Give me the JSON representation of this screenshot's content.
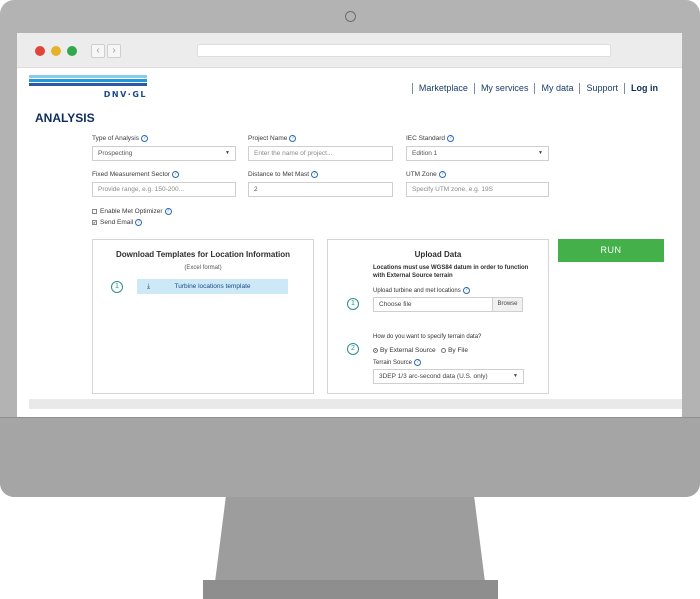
{
  "header": {
    "logo_text": "DNV·GL",
    "logo_colors": [
      "#8ccbe8",
      "#ffffff",
      "#1f9ad6",
      "#ffffff",
      "#2a5aa3"
    ],
    "nav": [
      "Marketplace",
      "My services",
      "My data",
      "Support",
      "Log in"
    ]
  },
  "page": {
    "title": "ANALYSIS"
  },
  "form": {
    "type_of_analysis": {
      "label": "Type of Analysis",
      "value": "Prospecting"
    },
    "project_name": {
      "label": "Project Name",
      "placeholder": "Enter the name of project..."
    },
    "iec_standard": {
      "label": "IEC Standard",
      "value": "Edition 1"
    },
    "fixed_measurement_sector": {
      "label": "Fixed Measurement Sector",
      "placeholder": "Provide range, e.g. 150-200..."
    },
    "distance_to_met_mast": {
      "label": "Distance to Met Mast",
      "value": "2"
    },
    "utm_zone": {
      "label": "UTM Zone",
      "placeholder": "Specify UTM zone, e.g. 19S"
    },
    "enable_met_optimizer": {
      "label": "Enable Met Optimizer",
      "checked": false
    },
    "send_email": {
      "label": "Send Email",
      "checked": true
    }
  },
  "download_panel": {
    "title": "Download Templates for Location Information",
    "subtitle": "(Excel format)",
    "step": "1",
    "template_button": "Turbine locations template"
  },
  "upload_panel": {
    "title": "Upload Data",
    "note": "Locations must use WGS84 datum in order to function with External Source terrain",
    "step1": "1",
    "upload_label": "Upload turbine and met locations",
    "file_placeholder": "Choose file",
    "browse": "Browse",
    "step2": "2",
    "terrain_question": "How do you want to specify terrain data?",
    "option_external": "By External Source",
    "option_file": "By File",
    "terrain_source_label": "Terrain Source",
    "terrain_source_value": "3DEP 1/3 arc-second data (U.S. only)"
  },
  "run_button": "RUN",
  "help_glyph": "?",
  "icons": {
    "back": "‹",
    "forward": "›",
    "caret": "▼",
    "download": "⤓",
    "check": "✔"
  },
  "colors": {
    "accent_green": "#43b04a",
    "brand_blue": "#0f2d5c",
    "template_bg": "#cde9f7"
  }
}
